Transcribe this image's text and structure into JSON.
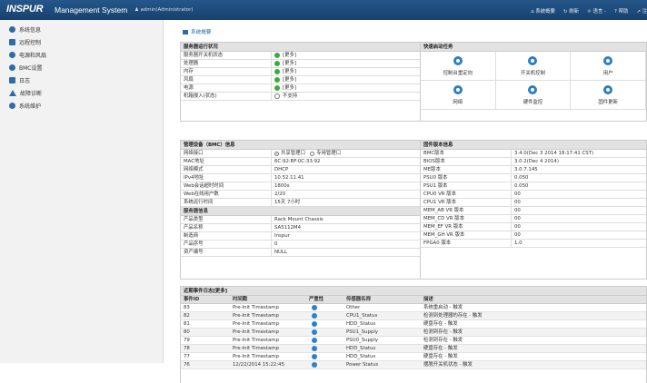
{
  "header": {
    "brand": "INSPUR",
    "system": "Management System",
    "user": "admin(Administrator)",
    "nav": [
      "系统概要",
      "刷新",
      "语言 -",
      "帮助",
      "注"
    ]
  },
  "sidebar": {
    "items": [
      {
        "label": "系统信息",
        "icon": "info-icon"
      },
      {
        "label": "远程控制",
        "icon": "monitor-icon"
      },
      {
        "label": "电源和风扇",
        "icon": "power-icon"
      },
      {
        "label": "BMC设置",
        "icon": "settings-icon"
      },
      {
        "label": "日志",
        "icon": "log-icon"
      },
      {
        "label": "故障诊断",
        "icon": "warning-icon"
      },
      {
        "label": "系统维护",
        "icon": "wrench-icon"
      }
    ]
  },
  "breadcrumb": "系统概要",
  "server_status": {
    "title": "服务器运行状况",
    "rows": [
      {
        "k": "服务器开关机状态",
        "v": "[更多]",
        "s": "ok"
      },
      {
        "k": "处理器",
        "v": "[更多]",
        "s": "ok"
      },
      {
        "k": "内存",
        "v": "[更多]",
        "s": "ok"
      },
      {
        "k": "风扇",
        "v": "[更多]",
        "s": "ok"
      },
      {
        "k": "电源",
        "v": "[更多]",
        "s": "ok"
      },
      {
        "k": "机箱侵入(状态)",
        "v": "不支持",
        "s": "na"
      }
    ]
  },
  "quick": {
    "title": "快速启动任务",
    "items": [
      "控制台重定向",
      "开关机控制",
      "用户",
      "网络",
      "硬件监控",
      "固件更新"
    ]
  },
  "bmc": {
    "title": "管理设备（BMC）信息",
    "port_label": "网络接口",
    "port_opts": [
      "共享管理口",
      "专用管理口"
    ],
    "rows": [
      {
        "k": "MAC地址",
        "v": "6C:92:BF:0C:33:92"
      },
      {
        "k": "网络模式",
        "v": "DHCP"
      },
      {
        "k": "IPv4地址",
        "v": "10.52.11.41"
      },
      {
        "k": "Web会话超时时间",
        "v": "1800s"
      },
      {
        "k": "Web在线用户数",
        "v": "2/20"
      },
      {
        "k": "系统运行时间",
        "v": "15天 7小时"
      }
    ],
    "server_info_title": "服务器信息",
    "server_rows": [
      {
        "k": "产品类型",
        "v": "Rack Mount Chassis"
      },
      {
        "k": "产品名称",
        "v": "SA5112M4"
      },
      {
        "k": "制造商",
        "v": "Inspur"
      },
      {
        "k": "产品序号",
        "v": "0"
      },
      {
        "k": "资产编号",
        "v": "NULL"
      }
    ]
  },
  "firmware": {
    "title": "固件版本信息",
    "rows": [
      {
        "k": "BMC版本",
        "v": "3.4.0(Dec 3 2014 18:17:41 CST)"
      },
      {
        "k": "BIOS版本",
        "v": "3.0.2(Dec 4 2014)"
      },
      {
        "k": "ME版本",
        "v": "3.0.7.145"
      },
      {
        "k": "PSU0 版本",
        "v": "0.050"
      },
      {
        "k": "PSU1 版本",
        "v": "0.050"
      },
      {
        "k": "CPU0 VR 版本",
        "v": "00"
      },
      {
        "k": "CPU1 VR 版本",
        "v": "00"
      },
      {
        "k": "MEM_AB VR 版本",
        "v": "00"
      },
      {
        "k": "MEM_CD VR 版本",
        "v": "00"
      },
      {
        "k": "MEM_EF VR 版本",
        "v": "00"
      },
      {
        "k": "MEM_GH VR 版本",
        "v": "00"
      },
      {
        "k": "FPGA0 版本",
        "v": "1.0"
      }
    ]
  },
  "events": {
    "title": "近期事件日志[更多]",
    "cols": [
      "事件ID",
      "时间戳",
      "严重性",
      "传感器名称",
      "描述"
    ],
    "rows": [
      {
        "id": "83",
        "ts": "Pre-Init Timestamp",
        "sensor": "Other",
        "desc": "系统重启动 - 触发"
      },
      {
        "id": "82",
        "ts": "Pre-Init Timestamp",
        "sensor": "CPU1_Status",
        "desc": "检测到处理器的存在 - 触发"
      },
      {
        "id": "81",
        "ts": "Pre-Init Timestamp",
        "sensor": "HDD_Status",
        "desc": "硬盘存在 - 触发"
      },
      {
        "id": "80",
        "ts": "Pre-Init Timestamp",
        "sensor": "PSU1_Supply",
        "desc": "检测到存在 - 触发"
      },
      {
        "id": "79",
        "ts": "Pre-Init Timestamp",
        "sensor": "PSU0_Supply",
        "desc": "检测到存在 - 触发"
      },
      {
        "id": "78",
        "ts": "Pre-Init Timestamp",
        "sensor": "HDD_Status",
        "desc": "硬盘存在 - 触发"
      },
      {
        "id": "77",
        "ts": "Pre-Init Timestamp",
        "sensor": "HDD_Status",
        "desc": "硬盘存在 - 触发"
      },
      {
        "id": "76",
        "ts": "12/22/2014 15:22:45",
        "sensor": "Power Status",
        "desc": "摆脱开关机状态 - 触发"
      }
    ]
  }
}
